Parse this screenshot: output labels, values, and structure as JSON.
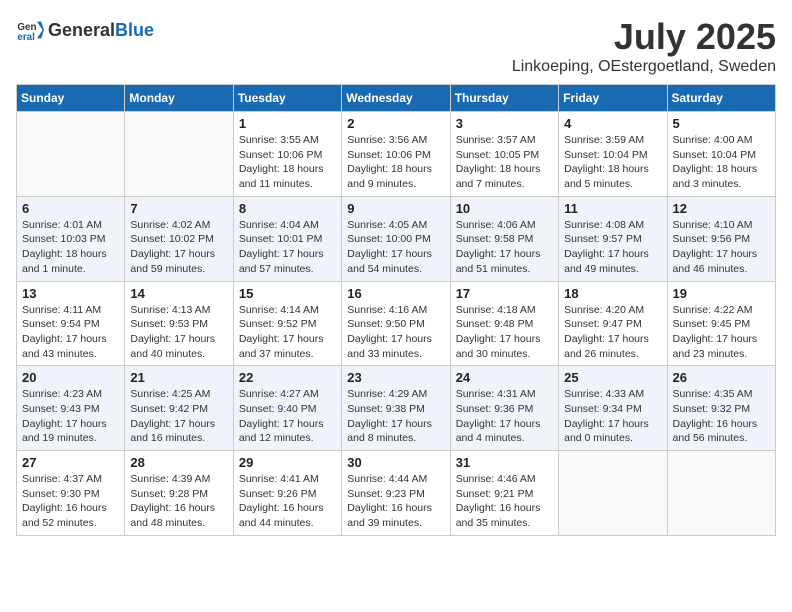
{
  "logo": {
    "general": "General",
    "blue": "Blue"
  },
  "title": {
    "month_year": "July 2025",
    "location": "Linkoeping, OEstergoetland, Sweden"
  },
  "weekdays": [
    "Sunday",
    "Monday",
    "Tuesday",
    "Wednesday",
    "Thursday",
    "Friday",
    "Saturday"
  ],
  "weeks": [
    [
      {
        "day": "",
        "sunrise": "",
        "sunset": "",
        "daylight": ""
      },
      {
        "day": "",
        "sunrise": "",
        "sunset": "",
        "daylight": ""
      },
      {
        "day": "1",
        "sunrise": "Sunrise: 3:55 AM",
        "sunset": "Sunset: 10:06 PM",
        "daylight": "Daylight: 18 hours and 11 minutes."
      },
      {
        "day": "2",
        "sunrise": "Sunrise: 3:56 AM",
        "sunset": "Sunset: 10:06 PM",
        "daylight": "Daylight: 18 hours and 9 minutes."
      },
      {
        "day": "3",
        "sunrise": "Sunrise: 3:57 AM",
        "sunset": "Sunset: 10:05 PM",
        "daylight": "Daylight: 18 hours and 7 minutes."
      },
      {
        "day": "4",
        "sunrise": "Sunrise: 3:59 AM",
        "sunset": "Sunset: 10:04 PM",
        "daylight": "Daylight: 18 hours and 5 minutes."
      },
      {
        "day": "5",
        "sunrise": "Sunrise: 4:00 AM",
        "sunset": "Sunset: 10:04 PM",
        "daylight": "Daylight: 18 hours and 3 minutes."
      }
    ],
    [
      {
        "day": "6",
        "sunrise": "Sunrise: 4:01 AM",
        "sunset": "Sunset: 10:03 PM",
        "daylight": "Daylight: 18 hours and 1 minute."
      },
      {
        "day": "7",
        "sunrise": "Sunrise: 4:02 AM",
        "sunset": "Sunset: 10:02 PM",
        "daylight": "Daylight: 17 hours and 59 minutes."
      },
      {
        "day": "8",
        "sunrise": "Sunrise: 4:04 AM",
        "sunset": "Sunset: 10:01 PM",
        "daylight": "Daylight: 17 hours and 57 minutes."
      },
      {
        "day": "9",
        "sunrise": "Sunrise: 4:05 AM",
        "sunset": "Sunset: 10:00 PM",
        "daylight": "Daylight: 17 hours and 54 minutes."
      },
      {
        "day": "10",
        "sunrise": "Sunrise: 4:06 AM",
        "sunset": "Sunset: 9:58 PM",
        "daylight": "Daylight: 17 hours and 51 minutes."
      },
      {
        "day": "11",
        "sunrise": "Sunrise: 4:08 AM",
        "sunset": "Sunset: 9:57 PM",
        "daylight": "Daylight: 17 hours and 49 minutes."
      },
      {
        "day": "12",
        "sunrise": "Sunrise: 4:10 AM",
        "sunset": "Sunset: 9:56 PM",
        "daylight": "Daylight: 17 hours and 46 minutes."
      }
    ],
    [
      {
        "day": "13",
        "sunrise": "Sunrise: 4:11 AM",
        "sunset": "Sunset: 9:54 PM",
        "daylight": "Daylight: 17 hours and 43 minutes."
      },
      {
        "day": "14",
        "sunrise": "Sunrise: 4:13 AM",
        "sunset": "Sunset: 9:53 PM",
        "daylight": "Daylight: 17 hours and 40 minutes."
      },
      {
        "day": "15",
        "sunrise": "Sunrise: 4:14 AM",
        "sunset": "Sunset: 9:52 PM",
        "daylight": "Daylight: 17 hours and 37 minutes."
      },
      {
        "day": "16",
        "sunrise": "Sunrise: 4:16 AM",
        "sunset": "Sunset: 9:50 PM",
        "daylight": "Daylight: 17 hours and 33 minutes."
      },
      {
        "day": "17",
        "sunrise": "Sunrise: 4:18 AM",
        "sunset": "Sunset: 9:48 PM",
        "daylight": "Daylight: 17 hours and 30 minutes."
      },
      {
        "day": "18",
        "sunrise": "Sunrise: 4:20 AM",
        "sunset": "Sunset: 9:47 PM",
        "daylight": "Daylight: 17 hours and 26 minutes."
      },
      {
        "day": "19",
        "sunrise": "Sunrise: 4:22 AM",
        "sunset": "Sunset: 9:45 PM",
        "daylight": "Daylight: 17 hours and 23 minutes."
      }
    ],
    [
      {
        "day": "20",
        "sunrise": "Sunrise: 4:23 AM",
        "sunset": "Sunset: 9:43 PM",
        "daylight": "Daylight: 17 hours and 19 minutes."
      },
      {
        "day": "21",
        "sunrise": "Sunrise: 4:25 AM",
        "sunset": "Sunset: 9:42 PM",
        "daylight": "Daylight: 17 hours and 16 minutes."
      },
      {
        "day": "22",
        "sunrise": "Sunrise: 4:27 AM",
        "sunset": "Sunset: 9:40 PM",
        "daylight": "Daylight: 17 hours and 12 minutes."
      },
      {
        "day": "23",
        "sunrise": "Sunrise: 4:29 AM",
        "sunset": "Sunset: 9:38 PM",
        "daylight": "Daylight: 17 hours and 8 minutes."
      },
      {
        "day": "24",
        "sunrise": "Sunrise: 4:31 AM",
        "sunset": "Sunset: 9:36 PM",
        "daylight": "Daylight: 17 hours and 4 minutes."
      },
      {
        "day": "25",
        "sunrise": "Sunrise: 4:33 AM",
        "sunset": "Sunset: 9:34 PM",
        "daylight": "Daylight: 17 hours and 0 minutes."
      },
      {
        "day": "26",
        "sunrise": "Sunrise: 4:35 AM",
        "sunset": "Sunset: 9:32 PM",
        "daylight": "Daylight: 16 hours and 56 minutes."
      }
    ],
    [
      {
        "day": "27",
        "sunrise": "Sunrise: 4:37 AM",
        "sunset": "Sunset: 9:30 PM",
        "daylight": "Daylight: 16 hours and 52 minutes."
      },
      {
        "day": "28",
        "sunrise": "Sunrise: 4:39 AM",
        "sunset": "Sunset: 9:28 PM",
        "daylight": "Daylight: 16 hours and 48 minutes."
      },
      {
        "day": "29",
        "sunrise": "Sunrise: 4:41 AM",
        "sunset": "Sunset: 9:26 PM",
        "daylight": "Daylight: 16 hours and 44 minutes."
      },
      {
        "day": "30",
        "sunrise": "Sunrise: 4:44 AM",
        "sunset": "Sunset: 9:23 PM",
        "daylight": "Daylight: 16 hours and 39 minutes."
      },
      {
        "day": "31",
        "sunrise": "Sunrise: 4:46 AM",
        "sunset": "Sunset: 9:21 PM",
        "daylight": "Daylight: 16 hours and 35 minutes."
      },
      {
        "day": "",
        "sunrise": "",
        "sunset": "",
        "daylight": ""
      },
      {
        "day": "",
        "sunrise": "",
        "sunset": "",
        "daylight": ""
      }
    ]
  ]
}
